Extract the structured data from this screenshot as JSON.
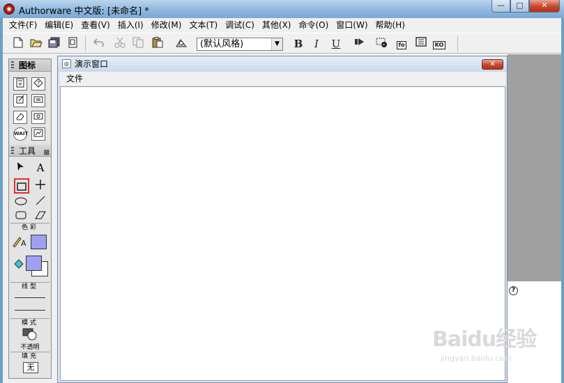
{
  "window": {
    "title": "Authorware 中文版: [未命名] *",
    "minimize_glyph": "—",
    "maximize_glyph": "□",
    "close_glyph": "✕"
  },
  "menu": [
    "文件(F)",
    "编辑(E)",
    "查看(V)",
    "插入(I)",
    "修改(M)",
    "文本(T)",
    "调试(C)",
    "其他(X)",
    "命令(O)",
    "窗口(W)",
    "帮助(H)"
  ],
  "toolbar": {
    "icons": [
      "new-file-icon",
      "open-file-icon",
      "save-all-icon",
      "import-icon",
      "undo-icon",
      "cut-icon",
      "copy-icon",
      "paste-icon",
      "find-icon",
      "bold-icon",
      "italic-icon",
      "underline-icon",
      "run-icon",
      "control-panel-icon",
      "functions-icon",
      "variables-icon",
      "knowledge-objects-icon"
    ],
    "style_value": "(默认风格)",
    "bold": "B",
    "italic": "I",
    "underline": "U",
    "functions_label": "fo",
    "ko_label": "KO"
  },
  "palette": {
    "icons_header": "图标",
    "wait_label": "WAIT",
    "tools_header": "工具",
    "text_tool": "A",
    "color_label": "色彩",
    "line_label": "线型",
    "mode_label": "模式",
    "mode_value": "不透明",
    "fill_label": "填充",
    "fill_value": "无",
    "colors": {
      "stroke": "#a0a0f0",
      "fill": "#a0a0f0",
      "bg": "#ffffff"
    }
  },
  "presentation": {
    "title": "演示窗口",
    "menu_file": "文件"
  },
  "help": {
    "glyph": "?"
  },
  "watermark": {
    "brand": "Baidu经验",
    "url": "jingyan.baidu.com"
  }
}
